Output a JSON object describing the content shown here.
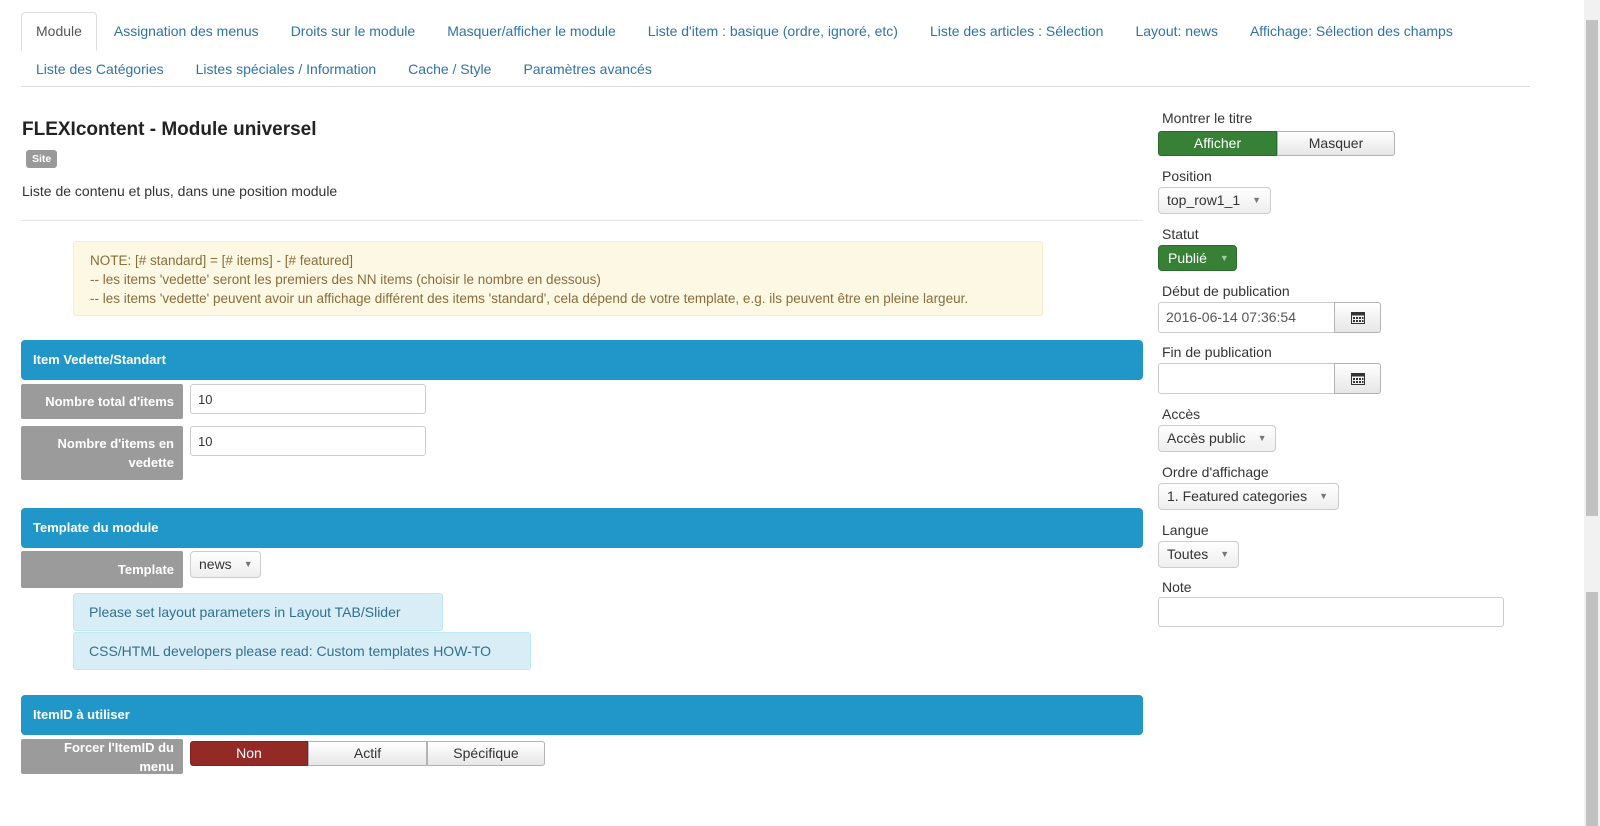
{
  "tabs": {
    "row1": [
      {
        "label": "Module",
        "active": true
      },
      {
        "label": "Assignation des menus"
      },
      {
        "label": "Droits sur le module"
      },
      {
        "label": "Masquer/afficher le module"
      },
      {
        "label": "Liste d'item : basique (ordre, ignoré, etc)"
      },
      {
        "label": "Liste des articles : Sélection"
      },
      {
        "label": "Layout: news"
      },
      {
        "label": "Affichage: Sélection des champs"
      }
    ],
    "row2": [
      {
        "label": "Liste des Catégories"
      },
      {
        "label": "Listes spéciales / Information"
      },
      {
        "label": "Cache / Style"
      },
      {
        "label": "Paramètres avancés"
      }
    ]
  },
  "module": {
    "title": "FLEXIcontent - Module universel",
    "badge": "Site",
    "description": "Liste de contenu et plus, dans une position module"
  },
  "note": {
    "lines": [
      "NOTE: [# standard] = [# items] - [# featured]",
      "-- les items 'vedette' seront les premiers des NN items (choisir le nombre en dessous)",
      "-- les items 'vedette' peuvent avoir un affichage différent des items 'standard', cela dépend de votre template, e.g. ils peuvent être en pleine largeur."
    ]
  },
  "sections": {
    "featured": {
      "title": "Item Vedette/Standart",
      "total_label": "Nombre total d'items",
      "total_value": "10",
      "featured_label": "Nombre d'items en vedette",
      "featured_value": "10"
    },
    "template": {
      "title": "Template du module",
      "template_label": "Template",
      "template_value": "news",
      "info1": "Please set layout parameters in Layout TAB/Slider",
      "info2": "CSS/HTML developers please read: Custom templates HOW-TO"
    },
    "itemid": {
      "title": "ItemID à utiliser",
      "force_label": "Forcer l'ItemID du menu",
      "options": [
        "Non",
        "Actif",
        "Spécifique"
      ],
      "selected": "Non"
    }
  },
  "sidebar": {
    "show_title_label": "Montrer le titre",
    "show_title_options": [
      "Afficher",
      "Masquer"
    ],
    "show_title_selected": "Afficher",
    "position_label": "Position",
    "position_value": "top_row1_1",
    "status_label": "Statut",
    "status_value": "Publié",
    "publish_up_label": "Début de publication",
    "publish_up_value": "2016-06-14 07:36:54",
    "publish_down_label": "Fin de publication",
    "publish_down_value": "",
    "access_label": "Accès",
    "access_value": "Accès public",
    "ordering_label": "Ordre d'affichage",
    "ordering_value": "1. Featured categories",
    "language_label": "Langue",
    "language_value": "Toutes",
    "note_label": "Note",
    "note_value": ""
  },
  "colors": {
    "section_bar": "#2196c9",
    "active_green": "#378137",
    "active_red": "#942a25",
    "link_blue": "#3071a9"
  }
}
